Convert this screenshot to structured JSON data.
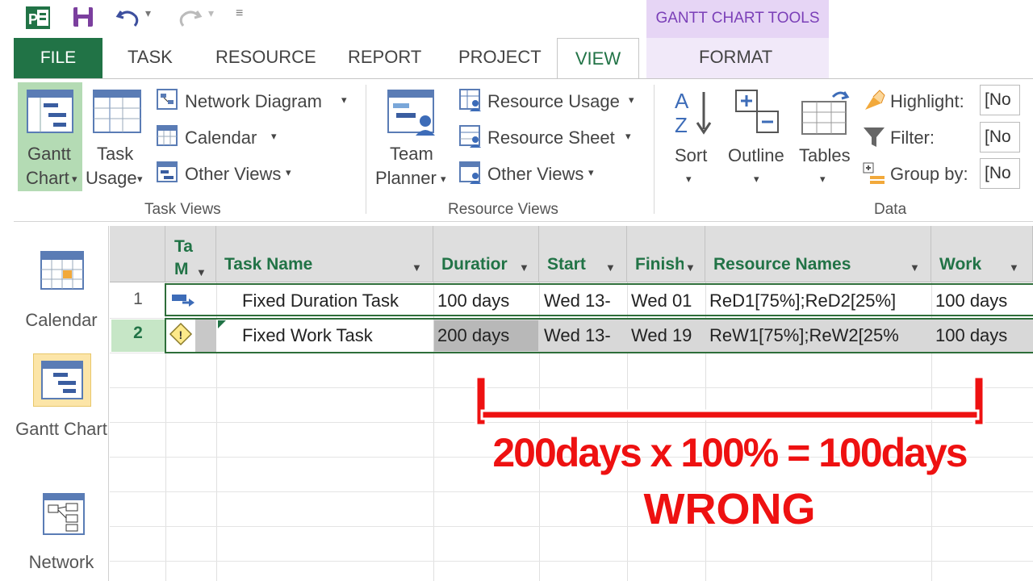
{
  "title_bar": {
    "context_tab_group": "GANTT CHART TOOLS"
  },
  "tabs": {
    "file": "FILE",
    "task": "TASK",
    "resource": "RESOURCE",
    "report": "REPORT",
    "project": "PROJECT",
    "view": "VIEW",
    "format": "FORMAT"
  },
  "ribbon": {
    "task_views": {
      "group_label": "Task Views",
      "gantt_chart": {
        "line1": "Gantt",
        "line2": "Chart"
      },
      "task_usage": {
        "line1": "Task",
        "line2": "Usage"
      },
      "network_diagram": "Network Diagram",
      "calendar": "Calendar",
      "other_views": "Other Views"
    },
    "resource_views": {
      "group_label": "Resource Views",
      "team_planner": {
        "line1": "Team",
        "line2": "Planner"
      },
      "resource_usage": "Resource Usage",
      "resource_sheet": "Resource Sheet",
      "other_views": "Other Views"
    },
    "data": {
      "group_label": "Data",
      "sort": "Sort",
      "outline": "Outline",
      "tables": "Tables",
      "highlight": "Highlight:",
      "filter": "Filter:",
      "group_by": "Group by:",
      "highlight_value": "[No",
      "filter_value": "[No",
      "group_by_value": "[No"
    }
  },
  "sidebar": {
    "items": [
      {
        "label": "Calendar"
      },
      {
        "label": "Gantt Chart"
      },
      {
        "label": "Network"
      }
    ]
  },
  "table": {
    "headers": {
      "mode_line1": "Ta",
      "mode_line2": "M",
      "task_name": "Task Name",
      "duration": "Duratior",
      "start": "Start",
      "finish": "Finish",
      "resource_names": "Resource Names",
      "work": "Work"
    },
    "rows": [
      {
        "id": "1",
        "task_name": "Fixed Duration Task",
        "duration": "100 days",
        "start": "Wed 13-",
        "finish": "Wed 01",
        "resource_names": "ReD1[75%];ReD2[25%]",
        "work": "100 days"
      },
      {
        "id": "2",
        "task_name": "Fixed Work Task",
        "duration": "200 days",
        "start": "Wed 13-",
        "finish": "Wed 19",
        "resource_names": "ReW1[75%];ReW2[25%",
        "work": "100 days"
      }
    ]
  },
  "annotation": {
    "line1": "200days x 100% = 100days",
    "line2": "WRONG",
    "color": "#ee1111"
  },
  "colors": {
    "accent": "#217346",
    "context_tab": "#7b40b8",
    "context_tab_bg": "#e6d5f5",
    "selected_row": "#d8d8d8"
  }
}
